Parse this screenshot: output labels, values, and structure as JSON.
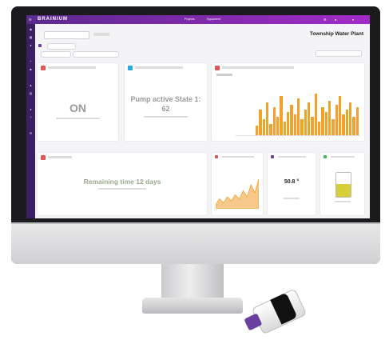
{
  "header": {
    "logo": "BRAINIUM",
    "nav": [
      "Projects",
      "Equipment"
    ]
  },
  "page": {
    "title": "Township Water Plant"
  },
  "widgets": {
    "status": {
      "value": "ON"
    },
    "pump": {
      "line1": "Pump active State 1:",
      "line2": "62"
    },
    "remaining": {
      "value": "Remaining time 12 days"
    },
    "small_value": {
      "value": "50.8 °"
    }
  },
  "colors": {
    "topbar_start": "#5b2a8e",
    "topbar_end": "#a32bc8",
    "sidebar": "#3a1f63",
    "accent_orange": "#f0a22a",
    "level_yellow": "#d7cf3a"
  },
  "chart_data": {
    "type": "bar",
    "values": [
      20,
      55,
      35,
      70,
      25,
      60,
      40,
      85,
      30,
      50,
      65,
      45,
      80,
      35,
      55,
      70,
      40,
      90,
      30,
      60,
      50,
      75,
      35,
      65,
      85,
      45,
      55,
      70,
      40,
      60
    ]
  },
  "mini_chart_data": {
    "type": "area",
    "values": [
      10,
      25,
      15,
      30,
      20,
      35,
      25,
      45,
      30,
      60,
      40,
      75
    ]
  }
}
